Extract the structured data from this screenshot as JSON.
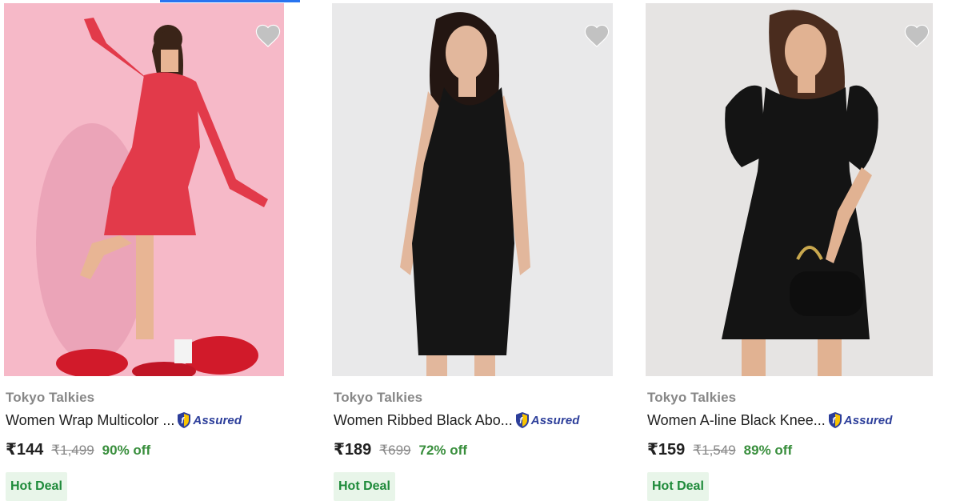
{
  "products": [
    {
      "brand": "Tokyo Talkies",
      "title": "Women Wrap Multicolor ...",
      "assured_label": "Assured",
      "price": "₹144",
      "mrp": "₹1,499",
      "discount": "90% off",
      "badge": "Hot Deal",
      "wishlist_icon": "heart-icon",
      "image_bg": "#f6b9c8",
      "dress_color": "#e23a4a"
    },
    {
      "brand": "Tokyo Talkies",
      "title": "Women Ribbed Black Abo...",
      "assured_label": "Assured",
      "price": "₹189",
      "mrp": "₹699",
      "discount": "72% off",
      "badge": "Hot Deal",
      "wishlist_icon": "heart-icon",
      "image_bg": "#e9e9ea",
      "dress_color": "#151515"
    },
    {
      "brand": "Tokyo Talkies",
      "title": "Women A-line Black Knee...",
      "assured_label": "Assured",
      "price": "₹159",
      "mrp": "₹1,549",
      "discount": "89% off",
      "badge": "Hot Deal",
      "wishlist_icon": "heart-icon",
      "image_bg": "#e6e4e3",
      "dress_color": "#141414"
    }
  ],
  "colors": {
    "brand_text": "#878787",
    "discount_green": "#388e3c",
    "hot_deal_bg": "#e8f5e9",
    "assured_blue": "#2c3e9a",
    "accent": "#2874f0"
  }
}
